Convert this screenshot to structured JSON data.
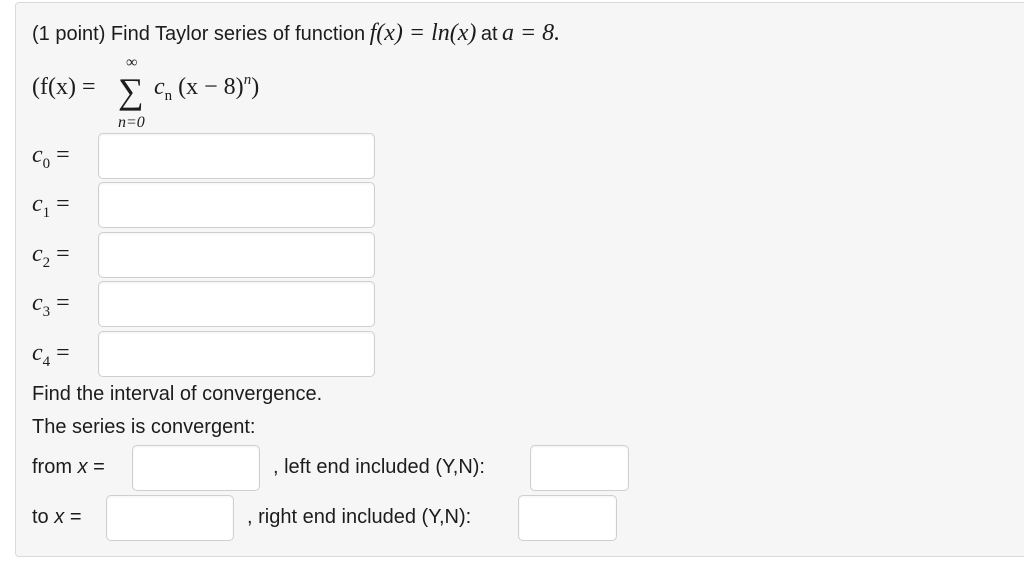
{
  "problem": {
    "points_label": "(1 point) Find Taylor series of function",
    "func": "f(x) = ln(x)",
    "at_text": "at",
    "a_eq": "a = 8."
  },
  "series": {
    "open": "(f(x) =",
    "sigma": "∑",
    "upper": "∞",
    "lower": "n=0",
    "c": "c",
    "c_sub": "n",
    "term": "(x − 8)",
    "exp": "n",
    "close": ")"
  },
  "coefficients": [
    {
      "c": "c",
      "sub": "0",
      "eq": "=",
      "value": ""
    },
    {
      "c": "c",
      "sub": "1",
      "eq": "=",
      "value": ""
    },
    {
      "c": "c",
      "sub": "2",
      "eq": "=",
      "value": ""
    },
    {
      "c": "c",
      "sub": "3",
      "eq": "=",
      "value": ""
    },
    {
      "c": "c",
      "sub": "4",
      "eq": "=",
      "value": ""
    }
  ],
  "convergence": {
    "heading": "Find the interval of convergence.",
    "subheading": "The series is convergent:",
    "from_label": "from",
    "from_var": "x",
    "from_eq": "=",
    "from_value": "",
    "left_end_label": ", left end included (Y,N):",
    "left_end_value": "",
    "to_label": "to",
    "to_var": "x",
    "to_eq": "=",
    "to_value": "",
    "right_end_label": ", right end included (Y,N):",
    "right_end_value": ""
  }
}
